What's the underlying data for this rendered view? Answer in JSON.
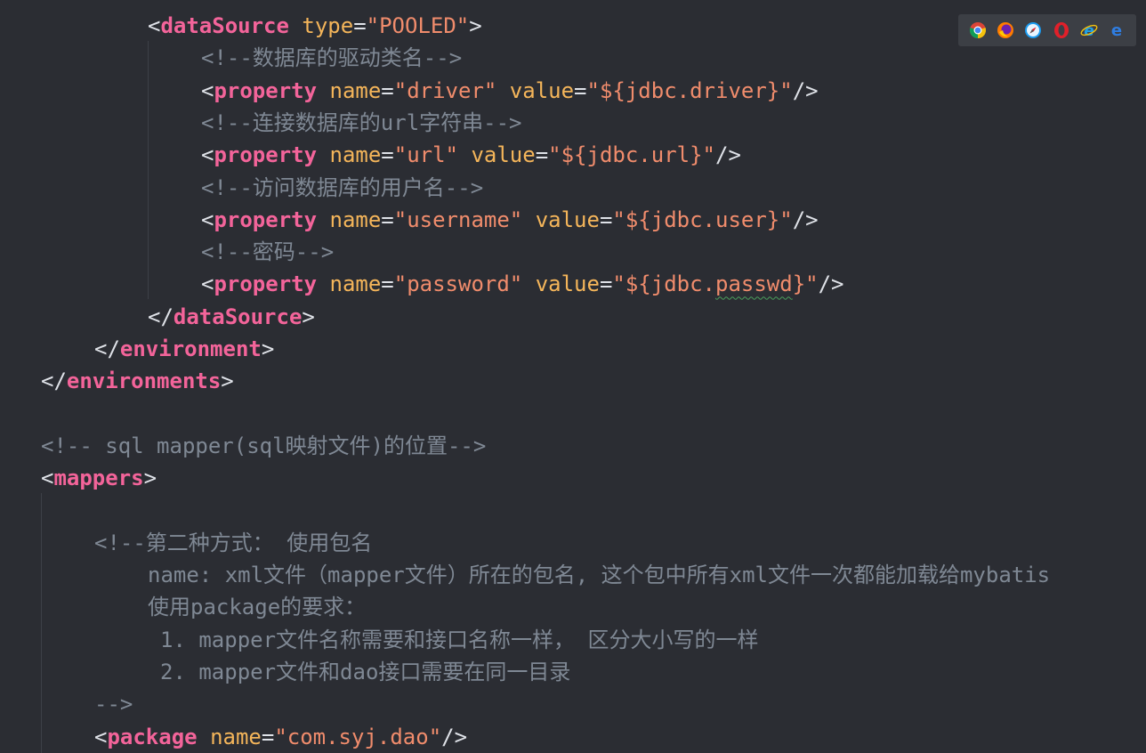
{
  "editor": {
    "lines": [
      {
        "indent": 166,
        "tokens": [
          {
            "t": "br",
            "v": "<"
          },
          {
            "t": "tag",
            "v": "dataSource"
          },
          {
            "t": "text",
            "v": " "
          },
          {
            "t": "attr",
            "v": "type"
          },
          {
            "t": "br",
            "v": "="
          },
          {
            "t": "val",
            "v": "\"POOLED\""
          },
          {
            "t": "br",
            "v": ">"
          }
        ]
      },
      {
        "indent": 226,
        "tokens": [
          {
            "t": "com",
            "v": "<!--数据库的驱动类名-->"
          }
        ]
      },
      {
        "indent": 226,
        "tokens": [
          {
            "t": "br",
            "v": "<"
          },
          {
            "t": "tag",
            "v": "property"
          },
          {
            "t": "text",
            "v": " "
          },
          {
            "t": "attr",
            "v": "name"
          },
          {
            "t": "br",
            "v": "="
          },
          {
            "t": "val",
            "v": "\"driver\""
          },
          {
            "t": "text",
            "v": " "
          },
          {
            "t": "attr",
            "v": "value"
          },
          {
            "t": "br",
            "v": "="
          },
          {
            "t": "val",
            "v": "\"${jdbc.driver}\""
          },
          {
            "t": "br",
            "v": "/>"
          }
        ]
      },
      {
        "indent": 226,
        "tokens": [
          {
            "t": "com",
            "v": "<!--连接数据库的url字符串-->"
          }
        ]
      },
      {
        "indent": 226,
        "tokens": [
          {
            "t": "br",
            "v": "<"
          },
          {
            "t": "tag",
            "v": "property"
          },
          {
            "t": "text",
            "v": " "
          },
          {
            "t": "attr",
            "v": "name"
          },
          {
            "t": "br",
            "v": "="
          },
          {
            "t": "val",
            "v": "\"url\""
          },
          {
            "t": "text",
            "v": " "
          },
          {
            "t": "attr",
            "v": "value"
          },
          {
            "t": "br",
            "v": "="
          },
          {
            "t": "val",
            "v": "\"${jdbc.url}\""
          },
          {
            "t": "br",
            "v": "/>"
          }
        ]
      },
      {
        "indent": 226,
        "tokens": [
          {
            "t": "com",
            "v": "<!--访问数据库的用户名-->"
          }
        ]
      },
      {
        "indent": 226,
        "tokens": [
          {
            "t": "br",
            "v": "<"
          },
          {
            "t": "tag",
            "v": "property"
          },
          {
            "t": "text",
            "v": " "
          },
          {
            "t": "attr",
            "v": "name"
          },
          {
            "t": "br",
            "v": "="
          },
          {
            "t": "val",
            "v": "\"username\""
          },
          {
            "t": "text",
            "v": " "
          },
          {
            "t": "attr",
            "v": "value"
          },
          {
            "t": "br",
            "v": "="
          },
          {
            "t": "val",
            "v": "\"${jdbc.user}\""
          },
          {
            "t": "br",
            "v": "/>"
          }
        ]
      },
      {
        "indent": 226,
        "tokens": [
          {
            "t": "com",
            "v": "<!--密码-->"
          }
        ]
      },
      {
        "indent": 226,
        "tokens": [
          {
            "t": "br",
            "v": "<"
          },
          {
            "t": "tag",
            "v": "property"
          },
          {
            "t": "text",
            "v": " "
          },
          {
            "t": "attr",
            "v": "name"
          },
          {
            "t": "br",
            "v": "="
          },
          {
            "t": "val",
            "v": "\"password\""
          },
          {
            "t": "text",
            "v": " "
          },
          {
            "t": "attr",
            "v": "value"
          },
          {
            "t": "br",
            "v": "="
          },
          {
            "t": "val",
            "v": "\"${jdbc."
          },
          {
            "t": "val",
            "v": "passwd",
            "squiggle": true
          },
          {
            "t": "val",
            "v": "}\""
          },
          {
            "t": "br",
            "v": "/>"
          }
        ]
      },
      {
        "indent": 166,
        "tokens": [
          {
            "t": "br",
            "v": "</"
          },
          {
            "t": "tag",
            "v": "dataSource"
          },
          {
            "t": "br",
            "v": ">"
          }
        ]
      },
      {
        "indent": 106,
        "tokens": [
          {
            "t": "br",
            "v": "</"
          },
          {
            "t": "tag",
            "v": "environment"
          },
          {
            "t": "br",
            "v": ">"
          }
        ]
      },
      {
        "indent": 46,
        "tokens": [
          {
            "t": "br",
            "v": "</"
          },
          {
            "t": "tag",
            "v": "environments"
          },
          {
            "t": "br",
            "v": ">"
          }
        ]
      },
      {
        "indent": 46,
        "tokens": []
      },
      {
        "indent": 46,
        "tokens": [
          {
            "t": "com",
            "v": "<!-- sql mapper(sql映射文件)的位置-->"
          }
        ]
      },
      {
        "indent": 46,
        "tokens": [
          {
            "t": "br",
            "v": "<"
          },
          {
            "t": "tag",
            "v": "mappers"
          },
          {
            "t": "br",
            "v": ">"
          }
        ]
      },
      {
        "indent": 46,
        "tokens": []
      },
      {
        "indent": 106,
        "tokens": [
          {
            "t": "com",
            "v": "<!--第二种方式： 使用包名"
          }
        ]
      },
      {
        "indent": 166,
        "tokens": [
          {
            "t": "com",
            "v": "name: xml文件（mapper文件）所在的包名, 这个包中所有xml文件一次都能加载给mybatis"
          }
        ]
      },
      {
        "indent": 166,
        "tokens": [
          {
            "t": "com",
            "v": "使用package的要求："
          }
        ]
      },
      {
        "indent": 180,
        "tokens": [
          {
            "t": "com",
            "v": "1. mapper文件名称需要和接口名称一样， 区分大小写的一样"
          }
        ]
      },
      {
        "indent": 180,
        "tokens": [
          {
            "t": "com",
            "v": "2. mapper文件和dao接口需要在同一目录"
          }
        ]
      },
      {
        "indent": 106,
        "tokens": [
          {
            "t": "com",
            "v": "-->"
          }
        ]
      },
      {
        "indent": 106,
        "tokens": [
          {
            "t": "br",
            "v": "<"
          },
          {
            "t": "tag",
            "v": "package"
          },
          {
            "t": "text",
            "v": " "
          },
          {
            "t": "attr",
            "v": "name"
          },
          {
            "t": "br",
            "v": "="
          },
          {
            "t": "val",
            "v": "\"com.syj.dao\""
          },
          {
            "t": "br",
            "v": "/>"
          }
        ]
      }
    ]
  },
  "browser_bar": {
    "icons": [
      {
        "name": "chrome-icon",
        "color": "#e8453c"
      },
      {
        "name": "firefox-icon",
        "color": "#ff7b00"
      },
      {
        "name": "safari-icon",
        "color": "#1a9bf0"
      },
      {
        "name": "opera-icon",
        "color": "#e0202a"
      },
      {
        "name": "ie-icon",
        "color": "#1ea1e8"
      },
      {
        "name": "edge-icon",
        "color": "#2f7de1"
      }
    ]
  },
  "colors": {
    "background": "#2b2d33",
    "tag": "#f3649a",
    "attribute": "#f4b55a",
    "value": "#f08c6c",
    "comment": "#7f8894",
    "bracket": "#dfe2e8"
  }
}
